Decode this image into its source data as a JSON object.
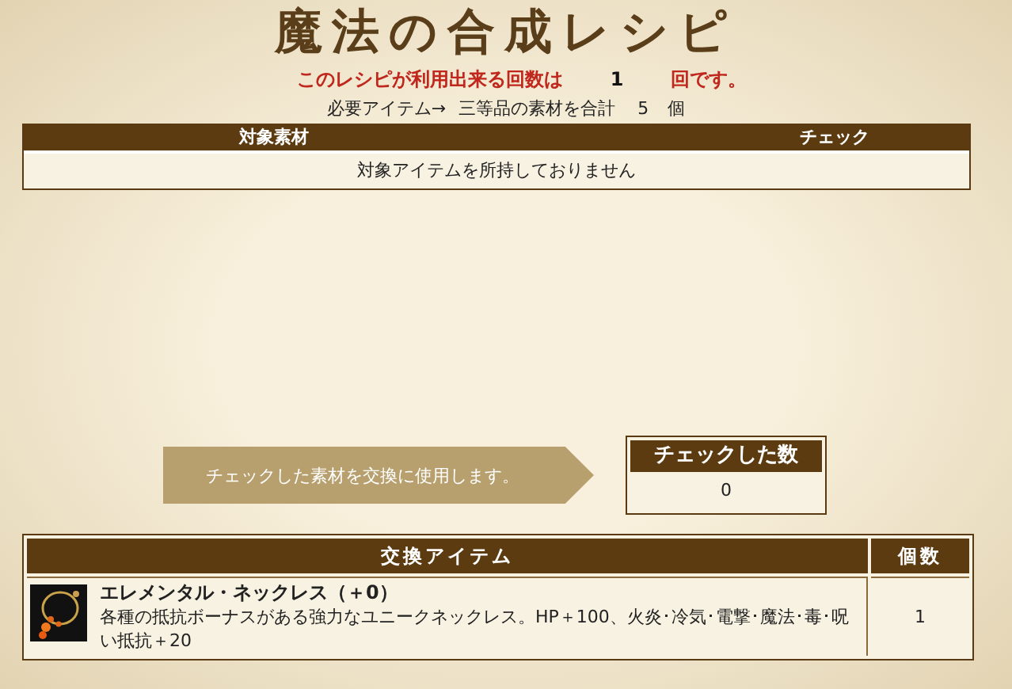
{
  "title": "魔法の合成レシピ",
  "usage": {
    "prefix": "このレシピが利用出来る回数は",
    "count": "1",
    "suffix": "回です。"
  },
  "requirement": {
    "label": "必要アイテム→",
    "text": "三等品の素材を合計",
    "count": "5",
    "unit": "個"
  },
  "materials_table": {
    "columns": [
      "対象素材",
      "チェック"
    ],
    "empty_message": "対象アイテムを所持しておりません"
  },
  "arrow_label": "チェックした素材を交換に使用します。",
  "checked_count": {
    "heading": "チェックした数",
    "value": "0"
  },
  "exchange_table": {
    "columns": [
      "交換アイテム",
      "個数"
    ],
    "rows": [
      {
        "name": "エレメンタル・ネックレス（＋0）",
        "description": "各種の抵抗ボーナスがある強力なユニークネックレス。HP＋100、火炎･冷気･電撃･魔法･毒･呪い抵抗＋20",
        "quantity": "1"
      }
    ]
  }
}
